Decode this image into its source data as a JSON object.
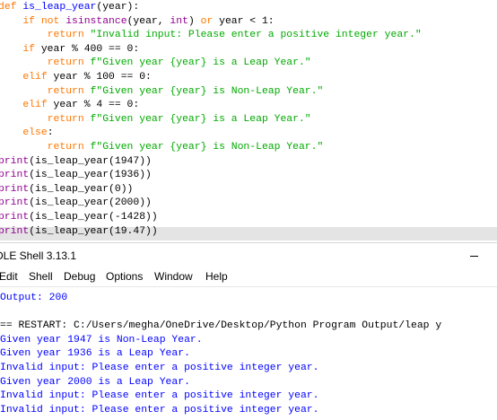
{
  "editor": {
    "lines": [
      [
        {
          "t": "def ",
          "c": "kw"
        },
        {
          "t": "is_leap_year",
          "c": "fn"
        },
        {
          "t": "(year):",
          "c": "tx"
        }
      ],
      [
        {
          "t": "    ",
          "c": "tx"
        },
        {
          "t": "if not ",
          "c": "kw"
        },
        {
          "t": "isinstance",
          "c": "bi"
        },
        {
          "t": "(year, ",
          "c": "tx"
        },
        {
          "t": "int",
          "c": "bi"
        },
        {
          "t": ") ",
          "c": "tx"
        },
        {
          "t": "or",
          "c": "kw"
        },
        {
          "t": " year < 1:",
          "c": "tx"
        }
      ],
      [
        {
          "t": "        ",
          "c": "tx"
        },
        {
          "t": "return ",
          "c": "kw"
        },
        {
          "t": "\"Invalid input: Please enter a positive integer year.\"",
          "c": "st"
        }
      ],
      [
        {
          "t": "    ",
          "c": "tx"
        },
        {
          "t": "if",
          "c": "kw"
        },
        {
          "t": " year % 400 == 0:",
          "c": "tx"
        }
      ],
      [
        {
          "t": "        ",
          "c": "tx"
        },
        {
          "t": "return ",
          "c": "kw"
        },
        {
          "t": "f\"Given year {year} is a Leap Year.\"",
          "c": "st"
        }
      ],
      [
        {
          "t": "    ",
          "c": "tx"
        },
        {
          "t": "elif",
          "c": "kw"
        },
        {
          "t": " year % 100 == 0:",
          "c": "tx"
        }
      ],
      [
        {
          "t": "        ",
          "c": "tx"
        },
        {
          "t": "return ",
          "c": "kw"
        },
        {
          "t": "f\"Given year {year} is Non-Leap Year.\"",
          "c": "st"
        }
      ],
      [
        {
          "t": "    ",
          "c": "tx"
        },
        {
          "t": "elif",
          "c": "kw"
        },
        {
          "t": " year % 4 == 0:",
          "c": "tx"
        }
      ],
      [
        {
          "t": "        ",
          "c": "tx"
        },
        {
          "t": "return ",
          "c": "kw"
        },
        {
          "t": "f\"Given year {year} is a Leap Year.\"",
          "c": "st"
        }
      ],
      [
        {
          "t": "    ",
          "c": "tx"
        },
        {
          "t": "else",
          "c": "kw"
        },
        {
          "t": ":",
          "c": "tx"
        }
      ],
      [
        {
          "t": "        ",
          "c": "tx"
        },
        {
          "t": "return ",
          "c": "kw"
        },
        {
          "t": "f\"Given year {year} is Non-Leap Year.\"",
          "c": "st"
        }
      ],
      [
        {
          "t": "print",
          "c": "bi"
        },
        {
          "t": "(is_leap_year(1947))",
          "c": "tx"
        }
      ],
      [
        {
          "t": "print",
          "c": "bi"
        },
        {
          "t": "(is_leap_year(1936))",
          "c": "tx"
        }
      ],
      [
        {
          "t": "print",
          "c": "bi"
        },
        {
          "t": "(is_leap_year(0))",
          "c": "tx"
        }
      ],
      [
        {
          "t": "print",
          "c": "bi"
        },
        {
          "t": "(is_leap_year(2000))",
          "c": "tx"
        }
      ],
      [
        {
          "t": "print",
          "c": "bi"
        },
        {
          "t": "(is_leap_year(-1428))",
          "c": "tx"
        }
      ],
      [
        {
          "t": "print",
          "c": "bi"
        },
        {
          "t": "(is_leap_year(19.47))",
          "c": "tx"
        }
      ]
    ]
  },
  "shell_window": {
    "title": "DLE Shell 3.13.1",
    "minimize_glyph": "—"
  },
  "menubar": {
    "items": [
      "Edit",
      "Shell",
      "Debug",
      "Options",
      "Window",
      "Help"
    ]
  },
  "shell": {
    "lines": [
      {
        "text": "Output: 200",
        "c": "out"
      },
      {
        "text": "",
        "c": "sep"
      },
      {
        "text": "== RESTART: C:/Users/megha/OneDrive/Desktop/Python Program Output/leap y",
        "c": "sep"
      },
      {
        "text": "Given year 1947 is Non-Leap Year.",
        "c": "out"
      },
      {
        "text": "Given year 1936 is a Leap Year.",
        "c": "out"
      },
      {
        "text": "Invalid input: Please enter a positive integer year.",
        "c": "out"
      },
      {
        "text": "Given year 2000 is a Leap Year.",
        "c": "out"
      },
      {
        "text": "Invalid input: Please enter a positive integer year.",
        "c": "out"
      },
      {
        "text": "Invalid input: Please enter a positive integer year.",
        "c": "out"
      }
    ]
  },
  "colors": {
    "keyword": "#ff7700",
    "builtin": "#900090",
    "definition": "#0000ff",
    "string": "#00aa00",
    "shell_output": "#0000ff"
  }
}
